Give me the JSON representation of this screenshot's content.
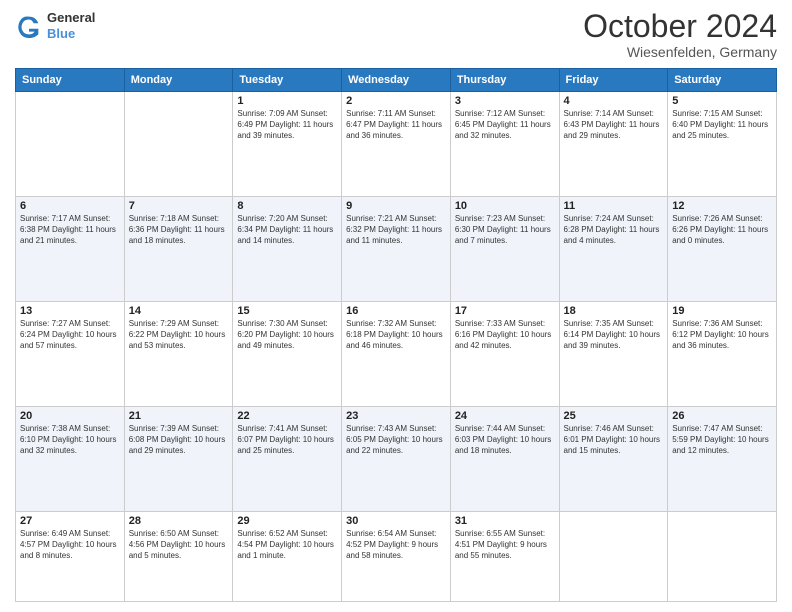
{
  "header": {
    "logo_line1": "General",
    "logo_line2": "Blue",
    "month": "October 2024",
    "location": "Wiesenfelden, Germany"
  },
  "weekdays": [
    "Sunday",
    "Monday",
    "Tuesday",
    "Wednesday",
    "Thursday",
    "Friday",
    "Saturday"
  ],
  "rows": [
    [
      {
        "day": "",
        "detail": ""
      },
      {
        "day": "",
        "detail": ""
      },
      {
        "day": "1",
        "detail": "Sunrise: 7:09 AM\nSunset: 6:49 PM\nDaylight: 11 hours and 39 minutes."
      },
      {
        "day": "2",
        "detail": "Sunrise: 7:11 AM\nSunset: 6:47 PM\nDaylight: 11 hours and 36 minutes."
      },
      {
        "day": "3",
        "detail": "Sunrise: 7:12 AM\nSunset: 6:45 PM\nDaylight: 11 hours and 32 minutes."
      },
      {
        "day": "4",
        "detail": "Sunrise: 7:14 AM\nSunset: 6:43 PM\nDaylight: 11 hours and 29 minutes."
      },
      {
        "day": "5",
        "detail": "Sunrise: 7:15 AM\nSunset: 6:40 PM\nDaylight: 11 hours and 25 minutes."
      }
    ],
    [
      {
        "day": "6",
        "detail": "Sunrise: 7:17 AM\nSunset: 6:38 PM\nDaylight: 11 hours and 21 minutes."
      },
      {
        "day": "7",
        "detail": "Sunrise: 7:18 AM\nSunset: 6:36 PM\nDaylight: 11 hours and 18 minutes."
      },
      {
        "day": "8",
        "detail": "Sunrise: 7:20 AM\nSunset: 6:34 PM\nDaylight: 11 hours and 14 minutes."
      },
      {
        "day": "9",
        "detail": "Sunrise: 7:21 AM\nSunset: 6:32 PM\nDaylight: 11 hours and 11 minutes."
      },
      {
        "day": "10",
        "detail": "Sunrise: 7:23 AM\nSunset: 6:30 PM\nDaylight: 11 hours and 7 minutes."
      },
      {
        "day": "11",
        "detail": "Sunrise: 7:24 AM\nSunset: 6:28 PM\nDaylight: 11 hours and 4 minutes."
      },
      {
        "day": "12",
        "detail": "Sunrise: 7:26 AM\nSunset: 6:26 PM\nDaylight: 11 hours and 0 minutes."
      }
    ],
    [
      {
        "day": "13",
        "detail": "Sunrise: 7:27 AM\nSunset: 6:24 PM\nDaylight: 10 hours and 57 minutes."
      },
      {
        "day": "14",
        "detail": "Sunrise: 7:29 AM\nSunset: 6:22 PM\nDaylight: 10 hours and 53 minutes."
      },
      {
        "day": "15",
        "detail": "Sunrise: 7:30 AM\nSunset: 6:20 PM\nDaylight: 10 hours and 49 minutes."
      },
      {
        "day": "16",
        "detail": "Sunrise: 7:32 AM\nSunset: 6:18 PM\nDaylight: 10 hours and 46 minutes."
      },
      {
        "day": "17",
        "detail": "Sunrise: 7:33 AM\nSunset: 6:16 PM\nDaylight: 10 hours and 42 minutes."
      },
      {
        "day": "18",
        "detail": "Sunrise: 7:35 AM\nSunset: 6:14 PM\nDaylight: 10 hours and 39 minutes."
      },
      {
        "day": "19",
        "detail": "Sunrise: 7:36 AM\nSunset: 6:12 PM\nDaylight: 10 hours and 36 minutes."
      }
    ],
    [
      {
        "day": "20",
        "detail": "Sunrise: 7:38 AM\nSunset: 6:10 PM\nDaylight: 10 hours and 32 minutes."
      },
      {
        "day": "21",
        "detail": "Sunrise: 7:39 AM\nSunset: 6:08 PM\nDaylight: 10 hours and 29 minutes."
      },
      {
        "day": "22",
        "detail": "Sunrise: 7:41 AM\nSunset: 6:07 PM\nDaylight: 10 hours and 25 minutes."
      },
      {
        "day": "23",
        "detail": "Sunrise: 7:43 AM\nSunset: 6:05 PM\nDaylight: 10 hours and 22 minutes."
      },
      {
        "day": "24",
        "detail": "Sunrise: 7:44 AM\nSunset: 6:03 PM\nDaylight: 10 hours and 18 minutes."
      },
      {
        "day": "25",
        "detail": "Sunrise: 7:46 AM\nSunset: 6:01 PM\nDaylight: 10 hours and 15 minutes."
      },
      {
        "day": "26",
        "detail": "Sunrise: 7:47 AM\nSunset: 5:59 PM\nDaylight: 10 hours and 12 minutes."
      }
    ],
    [
      {
        "day": "27",
        "detail": "Sunrise: 6:49 AM\nSunset: 4:57 PM\nDaylight: 10 hours and 8 minutes."
      },
      {
        "day": "28",
        "detail": "Sunrise: 6:50 AM\nSunset: 4:56 PM\nDaylight: 10 hours and 5 minutes."
      },
      {
        "day": "29",
        "detail": "Sunrise: 6:52 AM\nSunset: 4:54 PM\nDaylight: 10 hours and 1 minute."
      },
      {
        "day": "30",
        "detail": "Sunrise: 6:54 AM\nSunset: 4:52 PM\nDaylight: 9 hours and 58 minutes."
      },
      {
        "day": "31",
        "detail": "Sunrise: 6:55 AM\nSunset: 4:51 PM\nDaylight: 9 hours and 55 minutes."
      },
      {
        "day": "",
        "detail": ""
      },
      {
        "day": "",
        "detail": ""
      }
    ]
  ]
}
